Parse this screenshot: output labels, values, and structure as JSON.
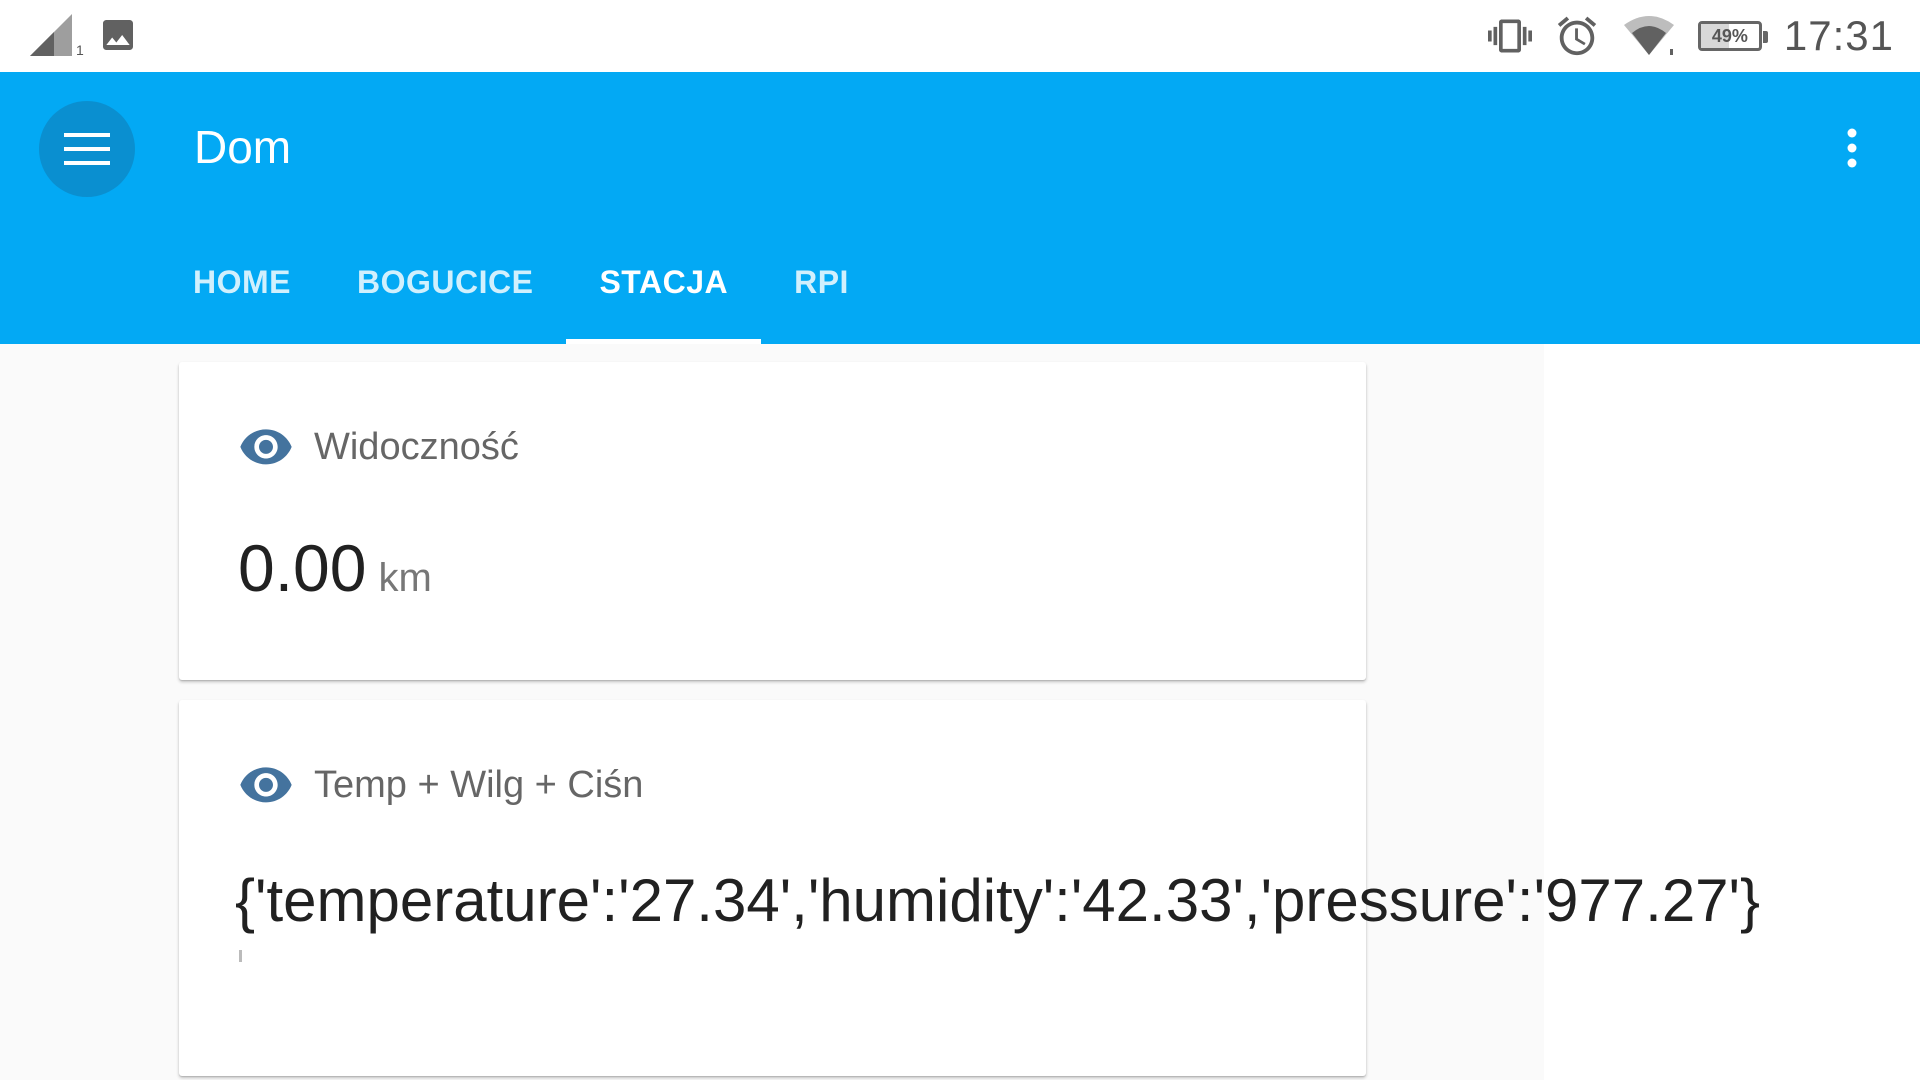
{
  "status_bar": {
    "sim_slot": "1",
    "battery": "49%",
    "battery_level": 0.49,
    "time": "17:31",
    "icons": [
      "signal-icon",
      "image-notification-icon",
      "vibrate-icon",
      "alarm-icon",
      "wifi-icon",
      "battery-icon"
    ]
  },
  "app_bar": {
    "title": "Dom",
    "background": "#03a9f4",
    "tabs": [
      {
        "label": "HOME"
      },
      {
        "label": "BOGUCICE"
      },
      {
        "label": "STACJA",
        "active": true
      },
      {
        "label": "RPI"
      }
    ]
  },
  "cards": [
    {
      "icon": "eye-icon",
      "name": "Widoczność",
      "value": "0.00",
      "unit": "km"
    },
    {
      "icon": "eye-icon",
      "name": "Temp + Wilg + Ciśn",
      "value": "{'temperature':'27.34','humidity':'42.33','pressure':'977.27'}"
    }
  ],
  "accent_icon_color": "#44739e"
}
